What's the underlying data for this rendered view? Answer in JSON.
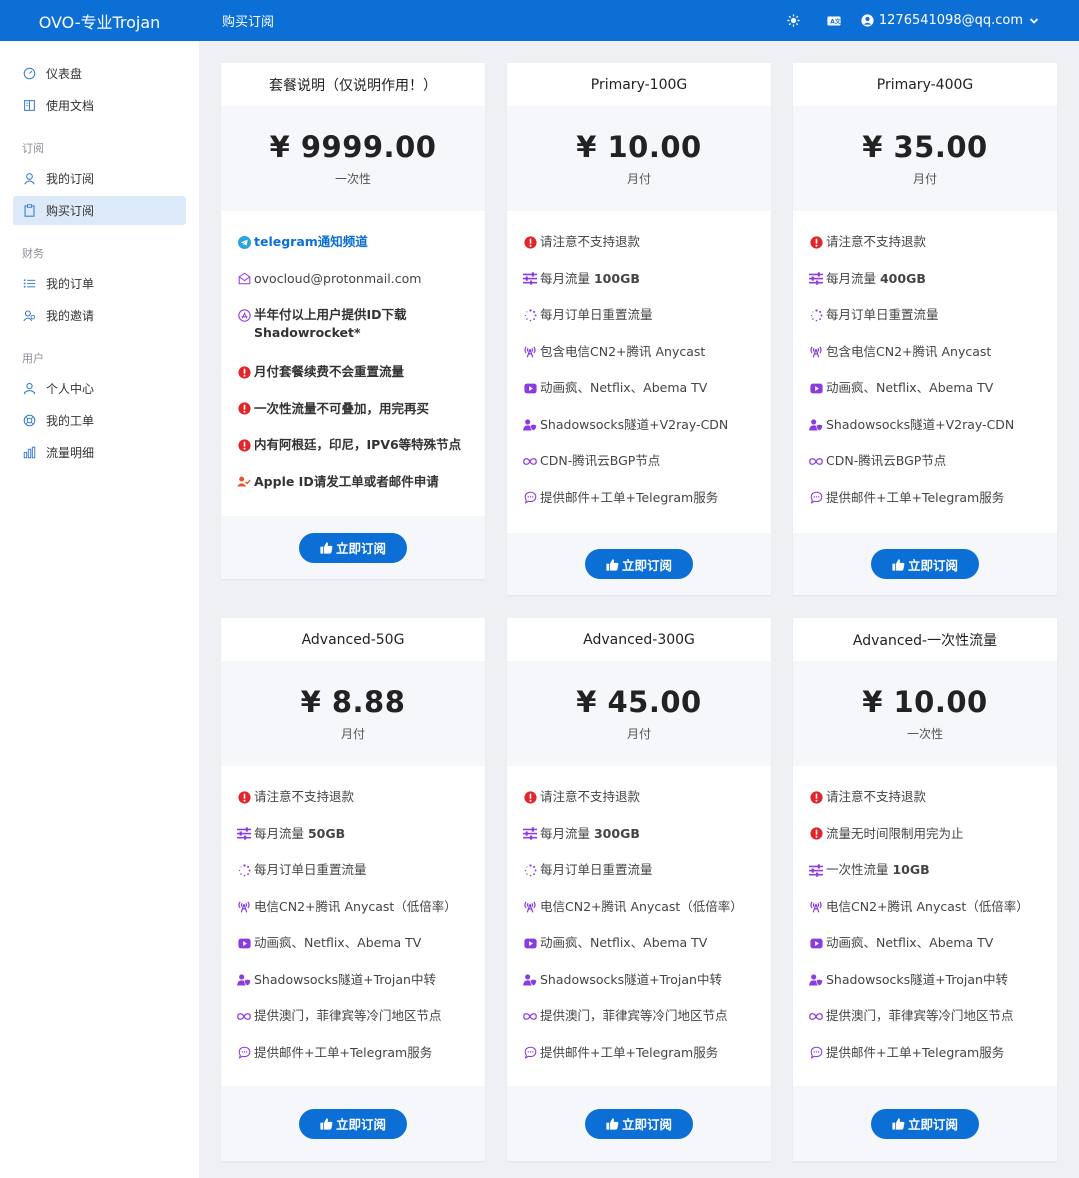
{
  "brand": "OVO-专业Trojan",
  "header": {
    "title": "购买订阅",
    "user_email": "1276541098@qq.com"
  },
  "sidebar": {
    "top": [
      {
        "label": "仪表盘",
        "icon": "gauge-icon"
      },
      {
        "label": "使用文档",
        "icon": "book-icon"
      }
    ],
    "groups": [
      {
        "title": "订阅",
        "items": [
          {
            "label": "我的订阅",
            "icon": "user-icon"
          },
          {
            "label": "购买订阅",
            "icon": "clipboard-icon",
            "active": true
          }
        ]
      },
      {
        "title": "财务",
        "items": [
          {
            "label": "我的订单",
            "icon": "list-icon"
          },
          {
            "label": "我的邀请",
            "icon": "users-icon"
          }
        ]
      },
      {
        "title": "用户",
        "items": [
          {
            "label": "个人中心",
            "icon": "person-icon"
          },
          {
            "label": "我的工单",
            "icon": "support-icon"
          },
          {
            "label": "流量明细",
            "icon": "bar-chart-icon"
          }
        ]
      }
    ]
  },
  "subscribe_label": "立即订阅",
  "plans": [
    {
      "name": "套餐说明（仅说明作用！）",
      "price": "¥ 9999.00",
      "period": "一次性",
      "features": [
        {
          "icon": "telegram-icon",
          "text": "telegram通知频道",
          "style": "link"
        },
        {
          "icon": "mail-icon",
          "text": "ovocloud@protonmail.com"
        },
        {
          "icon": "app-store-icon",
          "text": "半年付以上用户提供ID下载Shadowrocket*",
          "style": "bold"
        },
        {
          "icon": "alert-icon",
          "text": "月付套餐续费不会重置流量",
          "style": "bold"
        },
        {
          "icon": "alert-icon",
          "text": "一次性流量不可叠加，用完再买",
          "style": "bold"
        },
        {
          "icon": "alert-icon",
          "text": "内有阿根廷，印尼，IPV6等特殊节点",
          "style": "bold"
        },
        {
          "icon": "user-check-icon",
          "text": "Apple ID请发工单或者邮件申请",
          "style": "bold"
        }
      ]
    },
    {
      "name": "Primary-100G",
      "price": "¥ 10.00",
      "period": "月付",
      "features": [
        {
          "icon": "alert-icon",
          "text": "请注意不支持退款"
        },
        {
          "icon": "sliders-icon",
          "text": "每月流量 ",
          "strong": "100GB"
        },
        {
          "icon": "spinner-icon",
          "text": "每月订单日重置流量"
        },
        {
          "icon": "antenna-icon",
          "text": "包含电信CN2+腾讯 Anycast"
        },
        {
          "icon": "play-icon",
          "text": "动画疯、Netflix、Abema TV"
        },
        {
          "icon": "user-shield-icon",
          "text": "Shadowsocks隧道+V2ray-CDN"
        },
        {
          "icon": "infinity-icon",
          "text": "CDN-腾讯云BGP节点"
        },
        {
          "icon": "chat-icon",
          "text": "提供邮件+工单+Telegram服务"
        }
      ]
    },
    {
      "name": "Primary-400G",
      "price": "¥ 35.00",
      "period": "月付",
      "features": [
        {
          "icon": "alert-icon",
          "text": "请注意不支持退款"
        },
        {
          "icon": "sliders-icon",
          "text": "每月流量 ",
          "strong": "400GB"
        },
        {
          "icon": "spinner-icon",
          "text": "每月订单日重置流量"
        },
        {
          "icon": "antenna-icon",
          "text": "包含电信CN2+腾讯 Anycast"
        },
        {
          "icon": "play-icon",
          "text": "动画疯、Netflix、Abema TV"
        },
        {
          "icon": "user-shield-icon",
          "text": "Shadowsocks隧道+V2ray-CDN"
        },
        {
          "icon": "infinity-icon",
          "text": "CDN-腾讯云BGP节点"
        },
        {
          "icon": "chat-icon",
          "text": "提供邮件+工单+Telegram服务"
        }
      ]
    },
    {
      "name": "Advanced-50G",
      "price": "¥ 8.88",
      "period": "月付",
      "features": [
        {
          "icon": "alert-icon",
          "text": "请注意不支持退款"
        },
        {
          "icon": "sliders-icon",
          "text": "每月流量 ",
          "strong": "50GB"
        },
        {
          "icon": "spinner-icon",
          "text": "每月订单日重置流量"
        },
        {
          "icon": "antenna-icon",
          "text": "电信CN2+腾讯 Anycast（低倍率）"
        },
        {
          "icon": "play-icon",
          "text": "动画疯、Netflix、Abema TV"
        },
        {
          "icon": "user-shield-icon",
          "text": "Shadowsocks隧道+Trojan中转"
        },
        {
          "icon": "infinity-icon",
          "text": "提供澳门，菲律宾等冷门地区节点"
        },
        {
          "icon": "chat-icon",
          "text": "提供邮件+工单+Telegram服务"
        }
      ]
    },
    {
      "name": "Advanced-300G",
      "price": "¥ 45.00",
      "period": "月付",
      "features": [
        {
          "icon": "alert-icon",
          "text": "请注意不支持退款"
        },
        {
          "icon": "sliders-icon",
          "text": "每月流量 ",
          "strong": "300GB"
        },
        {
          "icon": "spinner-icon",
          "text": "每月订单日重置流量"
        },
        {
          "icon": "antenna-icon",
          "text": "电信CN2+腾讯 Anycast（低倍率）"
        },
        {
          "icon": "play-icon",
          "text": "动画疯、Netflix、Abema TV"
        },
        {
          "icon": "user-shield-icon",
          "text": "Shadowsocks隧道+Trojan中转"
        },
        {
          "icon": "infinity-icon",
          "text": "提供澳门，菲律宾等冷门地区节点"
        },
        {
          "icon": "chat-icon",
          "text": "提供邮件+工单+Telegram服务"
        }
      ]
    },
    {
      "name": "Advanced-一次性流量",
      "price": "¥ 10.00",
      "period": "一次性",
      "features": [
        {
          "icon": "alert-icon",
          "text": "请注意不支持退款"
        },
        {
          "icon": "alert-icon",
          "text": "流量无时间限制用完为止"
        },
        {
          "icon": "sliders-icon",
          "text": "一次性流量 ",
          "strong": "10GB"
        },
        {
          "icon": "antenna-icon",
          "text": "电信CN2+腾讯 Anycast（低倍率）"
        },
        {
          "icon": "play-icon",
          "text": "动画疯、Netflix、Abema TV"
        },
        {
          "icon": "user-shield-icon",
          "text": "Shadowsocks隧道+Trojan中转"
        },
        {
          "icon": "infinity-icon",
          "text": "提供澳门，菲律宾等冷门地区节点"
        },
        {
          "icon": "chat-icon",
          "text": "提供邮件+工单+Telegram服务"
        }
      ]
    }
  ],
  "colors": {
    "primary": "#0c6fd5",
    "alert": "#e0262a",
    "feature_icon": "#8a3ce0",
    "background": "#eef0f3"
  }
}
